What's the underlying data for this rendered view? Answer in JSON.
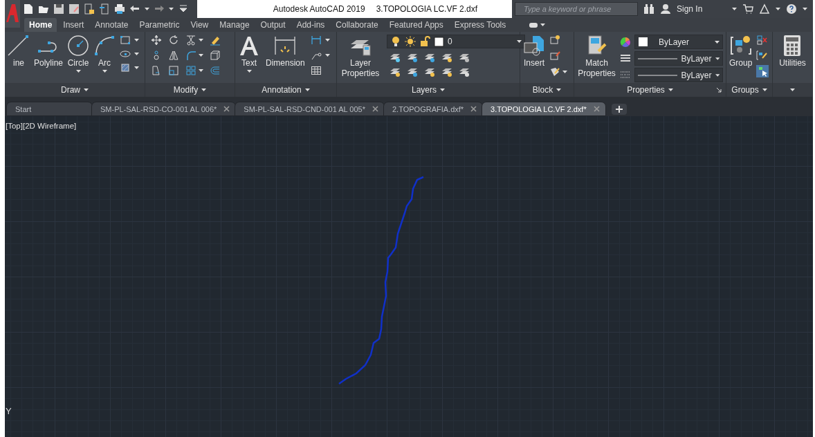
{
  "title_bar": {
    "app": "Autodesk AutoCAD 2019",
    "file": "3.TOPOLOGIA LC.VF 2.dxf"
  },
  "search": {
    "placeholder": "Type a keyword or phrase"
  },
  "sign_in": "Sign In",
  "ribbon_tabs": [
    {
      "label": "Home",
      "selected": true
    },
    {
      "label": "Insert",
      "selected": false
    },
    {
      "label": "Annotate",
      "selected": false
    },
    {
      "label": "Parametric",
      "selected": false
    },
    {
      "label": "View",
      "selected": false
    },
    {
      "label": "Manage",
      "selected": false
    },
    {
      "label": "Output",
      "selected": false
    },
    {
      "label": "Add-ins",
      "selected": false
    },
    {
      "label": "Collaborate",
      "selected": false
    },
    {
      "label": "Featured Apps",
      "selected": false
    },
    {
      "label": "Express Tools",
      "selected": false
    }
  ],
  "panels": [
    {
      "kind": "draw",
      "label": "Draw",
      "tools": [
        "ine",
        "Polyline",
        "Circle",
        "Arc"
      ]
    },
    {
      "kind": "modify",
      "label": "Modify"
    },
    {
      "kind": "annotation",
      "label": "Annotation",
      "tools": [
        "Text",
        "Dimension"
      ]
    },
    {
      "kind": "layers",
      "label": "Layers",
      "tools": [
        "Layer Properties"
      ],
      "layer": "0"
    },
    {
      "kind": "block",
      "label": "Block",
      "tools": [
        "Insert"
      ]
    },
    {
      "kind": "properties",
      "label": "Properties",
      "tools": [
        "Match Properties"
      ],
      "color_setting": "ByLayer",
      "lineweight": "ByLayer",
      "linetype": "ByLayer"
    },
    {
      "kind": "groups",
      "label": "Groups",
      "tools": [
        "Group"
      ]
    },
    {
      "kind": "utilities",
      "tools": [
        "Utilities"
      ]
    }
  ],
  "doc_tabs": [
    {
      "label": "Start",
      "selected": false,
      "closable": false
    },
    {
      "label": "SM-PL-SAL-RSD-CO-001 AL 006*",
      "selected": false,
      "closable": true
    },
    {
      "label": "SM-PL-SAL-RSD-CND-001 AL 005*",
      "selected": false,
      "closable": true
    },
    {
      "label": "2.TOPOGRAFIA.dxf*",
      "selected": false,
      "closable": true
    },
    {
      "label": "3.TOPOLOGIA LC.VF 2.dxf*",
      "selected": true,
      "closable": true
    }
  ],
  "viewport": {
    "label": "[Top][2D Wireframe]",
    "axis": "Y"
  }
}
